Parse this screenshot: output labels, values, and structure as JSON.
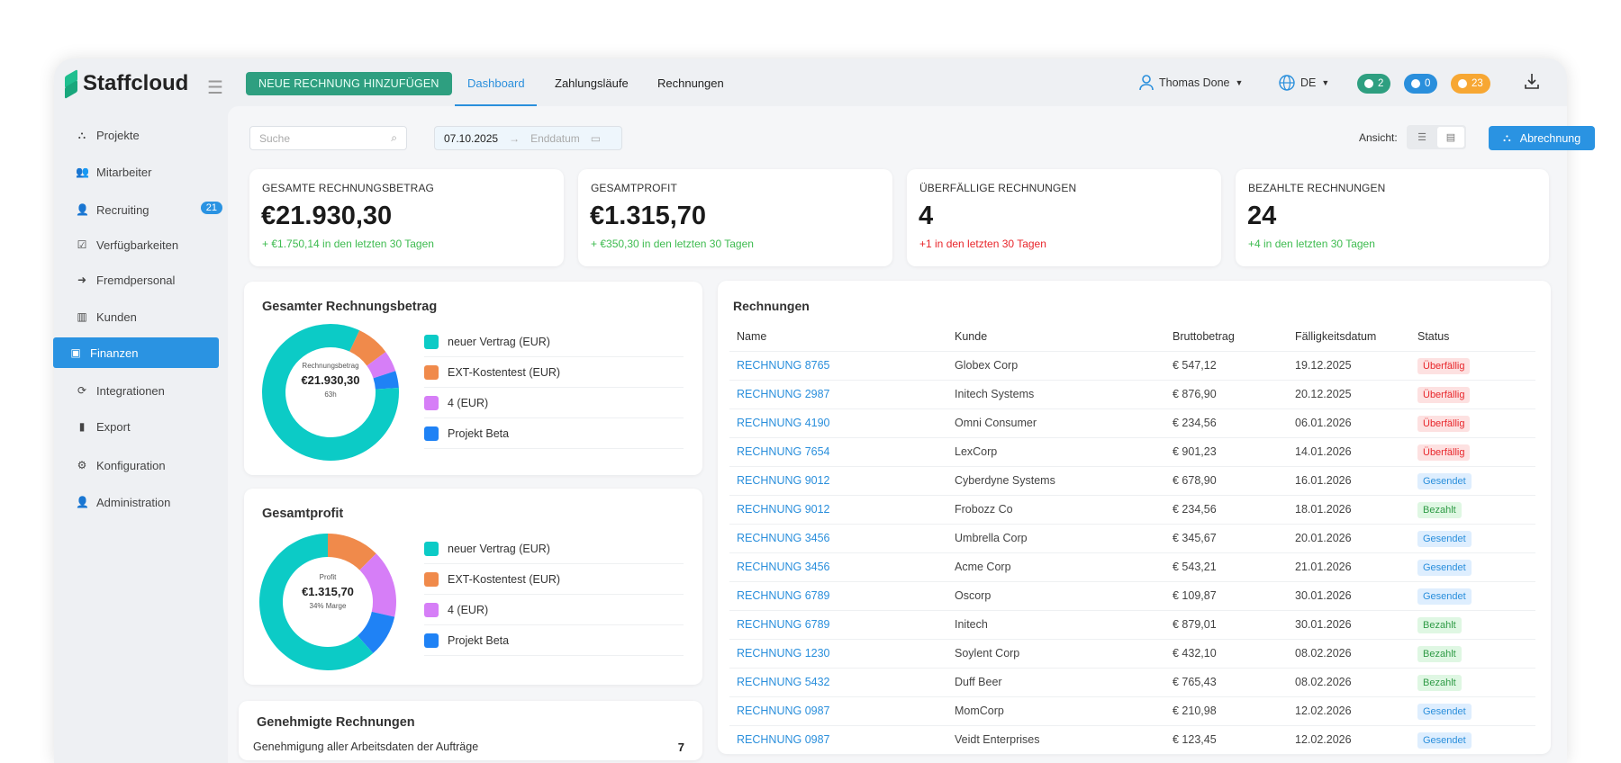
{
  "brand": {
    "name": "Staffcloud"
  },
  "header": {
    "new_invoice_button": "NEUE RECHNUNG HINZUFÜGEN",
    "tabs": [
      {
        "label": "Dashboard",
        "active": true
      },
      {
        "label": "Zahlungsläufe"
      },
      {
        "label": "Rechnungen"
      }
    ],
    "user": "Thomas Done",
    "language": "DE",
    "badges": [
      {
        "icon": "chat-icon",
        "count": "2",
        "color": "#2e9f80"
      },
      {
        "icon": "bell-icon",
        "count": "0",
        "color": "#2a8fdc"
      },
      {
        "icon": "clock-icon",
        "count": "23",
        "color": "#f7a733"
      }
    ]
  },
  "sidebar": {
    "items": [
      {
        "label": "Projekte",
        "icon": "sitemap-icon"
      },
      {
        "label": "Mitarbeiter",
        "icon": "users-icon"
      },
      {
        "label": "Recruiting",
        "icon": "user-plus-icon",
        "badge": "21"
      },
      {
        "label": "Verfügbarkeiten",
        "icon": "calendar-check-icon"
      },
      {
        "label": "Fremdpersonal",
        "icon": "sign-in-icon"
      },
      {
        "label": "Kunden",
        "icon": "building-icon"
      },
      {
        "label": "Finanzen",
        "icon": "money-icon",
        "active": true
      },
      {
        "label": "Integrationen",
        "icon": "sync-icon"
      },
      {
        "label": "Export",
        "icon": "file-icon"
      },
      {
        "label": "Konfiguration",
        "icon": "gear-icon"
      },
      {
        "label": "Administration",
        "icon": "user-cog-icon"
      }
    ]
  },
  "toolbar": {
    "search_placeholder": "Suche",
    "start_date": "07.10.2025",
    "end_date_placeholder": "Enddatum",
    "view_label": "Ansicht:",
    "billing_button": "Abrechnung"
  },
  "kpis": [
    {
      "label": "GESAMTE RECHNUNGSBETRAG",
      "value": "€21.930,30",
      "delta": "+ €1.750,14 in den letzten 30 Tagen",
      "trend": "green"
    },
    {
      "label": "GESAMTPROFIT",
      "value": "€1.315,70",
      "delta": "+ €350,30 in den letzten 30 Tagen",
      "trend": "green"
    },
    {
      "label": "ÜBERFÄLLIGE RECHNUNGEN",
      "value": "4",
      "delta": "+1 in den letzten 30 Tagen",
      "trend": "red"
    },
    {
      "label": "BEZAHLTE RECHNUNGEN",
      "value": "24",
      "delta": "+4 in den letzten 30 Tagen",
      "trend": "green"
    }
  ],
  "chart_data": [
    {
      "type": "pie",
      "title": "Gesamter Rechnungsbetrag",
      "center_label": "Rechnungsbetrag",
      "center_value": "€21.930,30",
      "center_sub": "63h",
      "categories": [
        "neuer Vertrag (EUR)",
        "EXT-Kostentest (EUR)",
        "4 (EUR)",
        "Projekt Beta"
      ],
      "values": [
        83,
        8,
        5,
        4
      ],
      "colors": [
        "#0ccbc6",
        "#f08a4b",
        "#d67ef7",
        "#1f82f5"
      ],
      "legend": "right"
    },
    {
      "type": "pie",
      "title": "Gesamtprofit",
      "center_label": "Profit",
      "center_value": "€1.315,70",
      "center_sub": "34% Marge",
      "categories": [
        "neuer Vertrag (EUR)",
        "EXT-Kostentest (EUR)",
        "4 (EUR)",
        "Projekt Beta"
      ],
      "values": [
        61.5,
        12.5,
        16,
        10
      ],
      "colors": [
        "#0ccbc6",
        "#f08a4b",
        "#d67ef7",
        "#1f82f5"
      ],
      "legend": "right"
    }
  ],
  "approved": {
    "title": "Genehmigte Rechnungen",
    "row_label": "Genehmigung aller Arbeitsdaten der Aufträge",
    "row_value": "7"
  },
  "invoices": {
    "title": "Rechnungen",
    "columns": [
      "Name",
      "Kunde",
      "Bruttobetrag",
      "Fälligkeitsdatum",
      "Status"
    ],
    "rows": [
      [
        "RECHNUNG 8765",
        "Globex Corp",
        "€ 547,12",
        "19.12.2025",
        "Überfällig"
      ],
      [
        "RECHNUNG 2987",
        "Initech Systems",
        "€ 876,90",
        "20.12.2025",
        "Überfällig"
      ],
      [
        "RECHNUNG 4190",
        "Omni Consumer",
        "€ 234,56",
        "06.01.2026",
        "Überfällig"
      ],
      [
        "RECHNUNG 7654",
        "LexCorp",
        "€ 901,23",
        "14.01.2026",
        "Überfällig"
      ],
      [
        "RECHNUNG 9012",
        "Cyberdyne Systems",
        "€ 678,90",
        "16.01.2026",
        "Gesendet"
      ],
      [
        "RECHNUNG 9012",
        "Frobozz Co",
        "€ 234,56",
        "18.01.2026",
        "Bezahlt"
      ],
      [
        "RECHNUNG 3456",
        "Umbrella Corp",
        "€ 345,67",
        "20.01.2026",
        "Gesendet"
      ],
      [
        "RECHNUNG 3456",
        "Acme Corp",
        "€ 543,21",
        "21.01.2026",
        "Gesendet"
      ],
      [
        "RECHNUNG 6789",
        "Oscorp",
        "€ 109,87",
        "30.01.2026",
        "Gesendet"
      ],
      [
        "RECHNUNG 6789",
        "Initech",
        "€ 879,01",
        "30.01.2026",
        "Bezahlt"
      ],
      [
        "RECHNUNG 1230",
        "Soylent Corp",
        "€ 432,10",
        "08.02.2026",
        "Bezahlt"
      ],
      [
        "RECHNUNG 5432",
        "Duff Beer",
        "€ 765,43",
        "08.02.2026",
        "Bezahlt"
      ],
      [
        "RECHNUNG 0987",
        "MomCorp",
        "€ 210,98",
        "12.02.2026",
        "Gesendet"
      ],
      [
        "RECHNUNG 0987",
        "Veidt Enterprises",
        "€ 123,45",
        "12.02.2026",
        "Gesendet"
      ]
    ]
  }
}
